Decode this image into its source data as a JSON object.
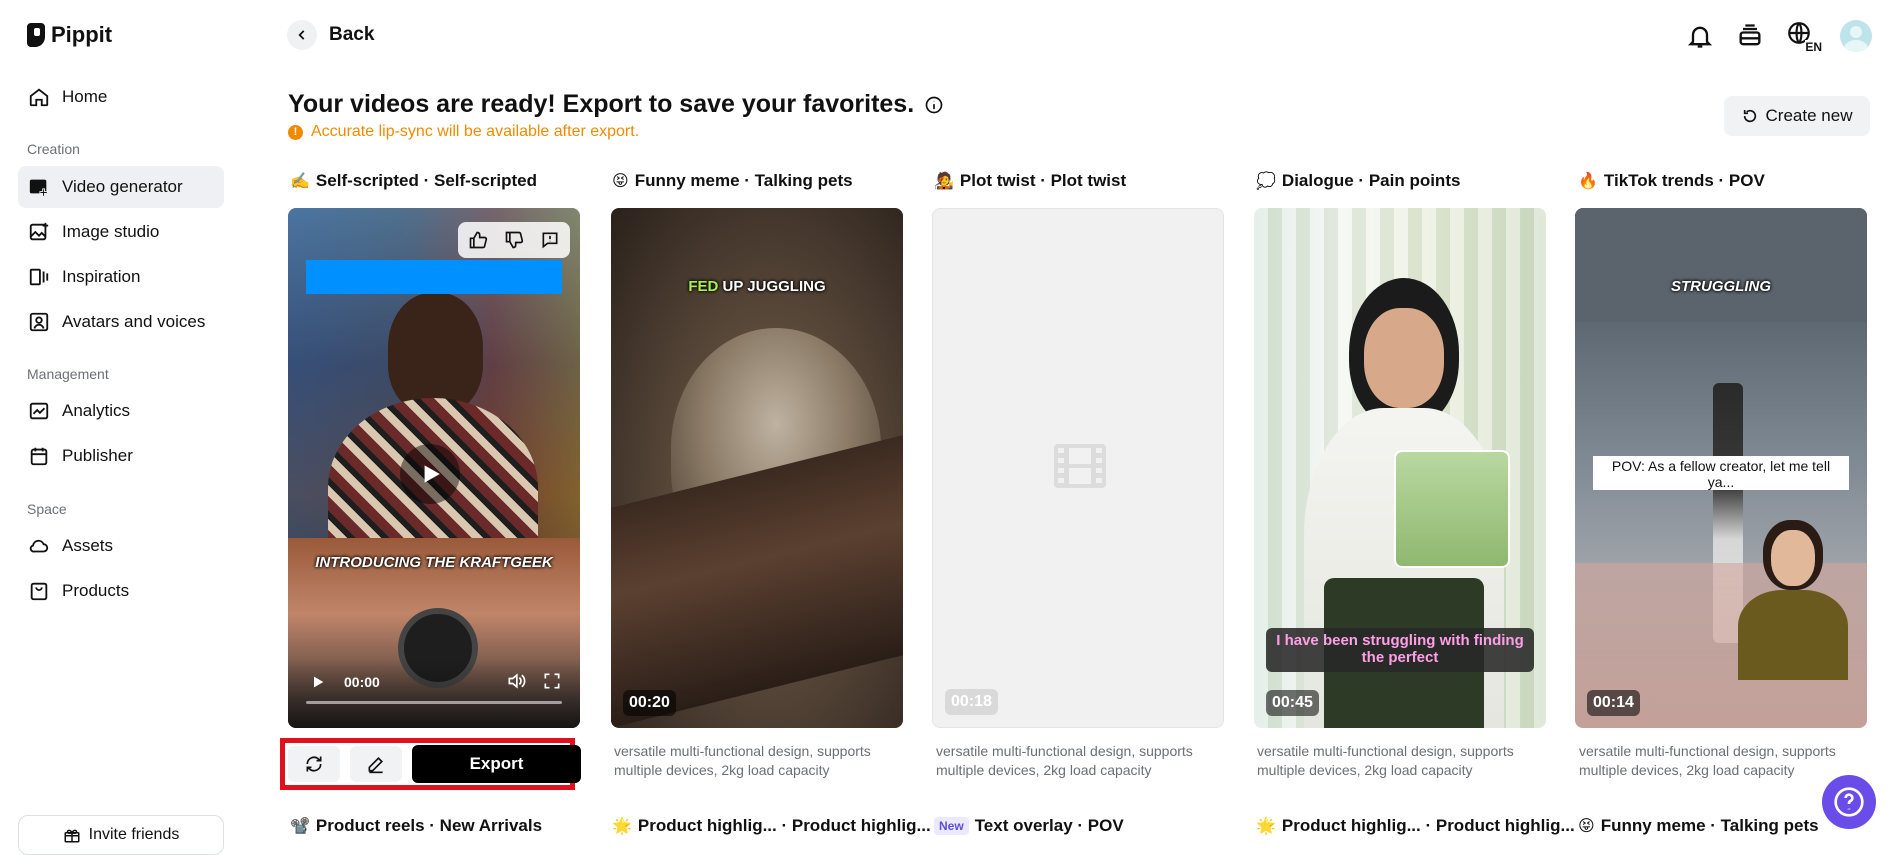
{
  "app": {
    "name": "Pippit"
  },
  "sidebar": {
    "items": [
      {
        "label": "Home"
      },
      {
        "label": "Video generator"
      },
      {
        "label": "Image studio"
      },
      {
        "label": "Inspiration"
      },
      {
        "label": "Avatars and voices"
      },
      {
        "label": "Analytics"
      },
      {
        "label": "Publisher"
      },
      {
        "label": "Assets"
      },
      {
        "label": "Products"
      }
    ],
    "sections": [
      "Creation",
      "Management",
      "Space"
    ],
    "invite_label": "Invite friends"
  },
  "header": {
    "back_label": "Back",
    "language": "EN"
  },
  "main": {
    "title": "Your videos are ready! Export to save your favorites.",
    "notice": "Accurate lip-sync will be available after export.",
    "create_new_label": "Create new",
    "columns": [
      {
        "emoji": "✍️",
        "label": "Self-scripted · Self-scripted"
      },
      {
        "emoji": "😝",
        "label": "Funny meme · Talking pets"
      },
      {
        "emoji": "🧑‍🎤",
        "label": "Plot twist · Plot twist"
      },
      {
        "emoji": "💭",
        "label": "Dialogue · Pain points"
      },
      {
        "emoji": "🔥",
        "label": "TikTok trends · POV"
      }
    ],
    "cards": [
      {
        "caption": "INTRODUCING THE KRAFTGEEK",
        "time": "00:00"
      },
      {
        "caption_green": "FED",
        "caption_rest": " UP JUGGLING",
        "duration": "00:20"
      },
      {
        "duration": "00:18"
      },
      {
        "caption": "I have been struggling with finding the perfect",
        "duration": "00:45"
      },
      {
        "caption_top": "STRUGGLING",
        "caption": "POV: As a fellow creator, let me tell ya...",
        "duration": "00:14"
      }
    ],
    "description": "versatile multi-functional design, supports multiple devices, 2kg load capacity",
    "export_label": "Export",
    "next_row": [
      {
        "emoji": "📽️",
        "label": "Product reels · New Arrivals"
      },
      {
        "emoji": "🌟",
        "label": "Product highlig... · Product highlig..."
      },
      {
        "badge": "New",
        "label": "Text overlay · POV"
      },
      {
        "emoji": "🌟",
        "label": "Product highlig... · Product highlig..."
      },
      {
        "emoji": "😝",
        "label": "Funny meme · Talking pets"
      }
    ]
  },
  "colors": {
    "accent": "#6a4de8",
    "warning": "#f08a00",
    "highlight_border": "#e0101c"
  }
}
